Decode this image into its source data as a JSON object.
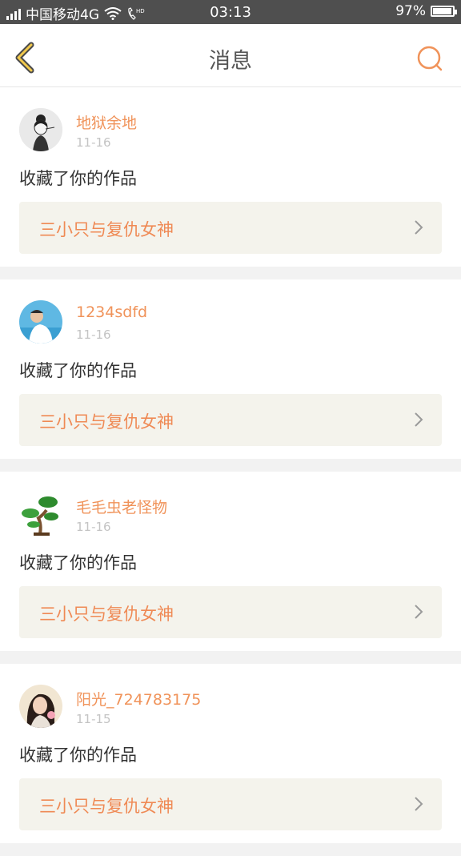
{
  "status_bar": {
    "network": "4G",
    "carrier": "中国移动4G",
    "time": "03:13",
    "battery": "97%",
    "battery_level": 0.97,
    "icons": [
      "signal-icon",
      "wifi-icon",
      "hd-call-icon",
      "battery-icon"
    ]
  },
  "nav": {
    "title": "消息",
    "back_icon": "back-chevron-icon",
    "search_icon": "search-icon",
    "accent": "#f0935a"
  },
  "messages": [
    {
      "user": "地狱余地",
      "date": "11-16",
      "action": "收藏了你的作品",
      "work": "三小只与复仇女神",
      "avatar": "avatar-girl-sketch"
    },
    {
      "user": "1234sdfd",
      "date": "11-16",
      "action": "收藏了你的作品",
      "work": "三小只与复仇女神",
      "avatar": "avatar-beach"
    },
    {
      "user": "毛毛虫老怪物",
      "date": "11-16",
      "action": "收藏了你的作品",
      "work": "三小只与复仇女神",
      "avatar": "avatar-bonsai"
    },
    {
      "user": "阳光_724783175",
      "date": "11-15",
      "action": "收藏了你的作品",
      "work": "三小只与复仇女神",
      "avatar": "avatar-woman"
    }
  ],
  "colors": {
    "status_bar_bg": "#4f4f4f",
    "username": "#f0935a",
    "work_title": "#ef8a55",
    "work_bg": "#f4f3ec",
    "date": "#c4c4c4"
  }
}
